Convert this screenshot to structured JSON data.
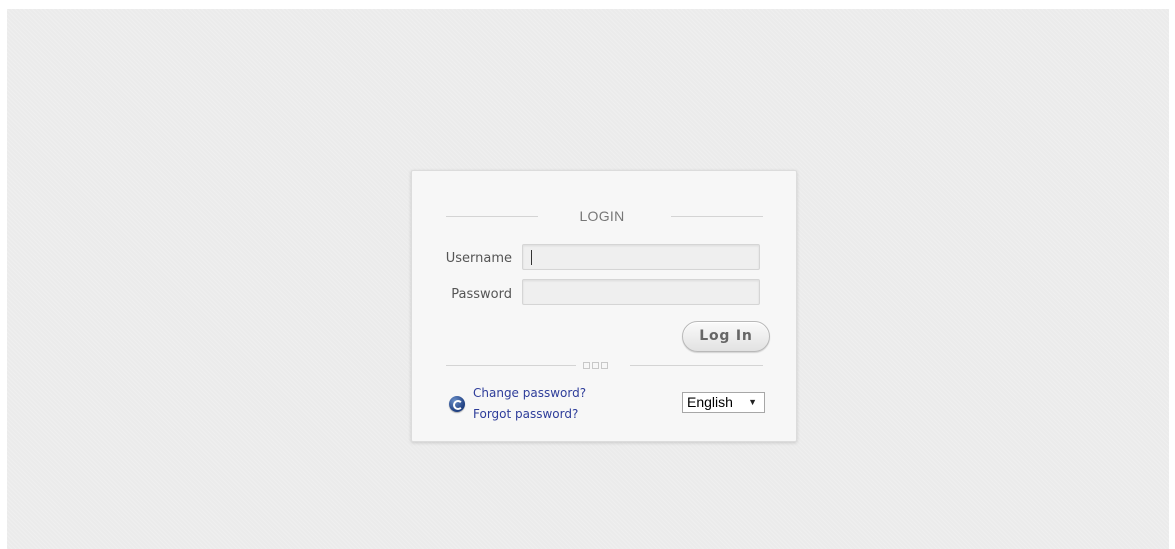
{
  "login_panel": {
    "title": "LOGIN",
    "username": {
      "label": "Username",
      "value": "",
      "placeholder": ""
    },
    "password": {
      "label": "Password",
      "value": "",
      "placeholder": ""
    },
    "login_button_label": "Log In",
    "links": {
      "change_password": "Change password?",
      "forgot_password": "Forgot password?"
    },
    "language": {
      "selected": "English"
    },
    "icons": {
      "help": "help-circle-icon",
      "dropdown": "triangle-down-icon"
    },
    "colors": {
      "link": "#2e3d9a",
      "panel_background": "#f7f7f7",
      "page_background": "#ebebeb",
      "icon": "#1e3e80"
    }
  }
}
